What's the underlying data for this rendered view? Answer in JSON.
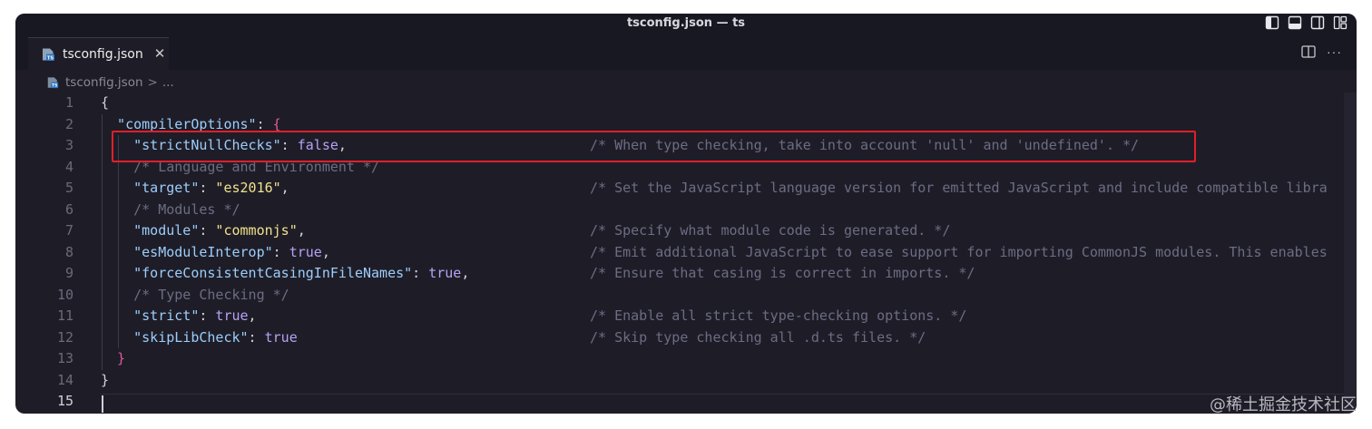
{
  "window": {
    "title": "tsconfig.json — ts"
  },
  "tabs": [
    {
      "label": "tsconfig.json",
      "close_glyph": "✕",
      "icon": "ts-file-icon"
    }
  ],
  "breadcrumb": {
    "file": "tsconfig.json",
    "separator": ">",
    "rest": "..."
  },
  "editor_actions": {
    "more_glyph": "···"
  },
  "colors": {
    "editor_background": "#1e1d27",
    "titlebar_background": "#181822",
    "key": "#9ccdfb",
    "string": "#f1e28e",
    "boolean": "#b7a2f6",
    "comment": "#6c6c84",
    "bracket_level_2": "#e05a9c",
    "highlight_border": "#e0202a"
  },
  "editor": {
    "active_line": "15",
    "lines": [
      {
        "number": "1",
        "punct_open": "{"
      },
      {
        "number": "2",
        "key": "\"compilerOptions\"",
        "colon": ": ",
        "bracket": "{"
      },
      {
        "number": "3",
        "key": "\"strictNullChecks\"",
        "colon": ": ",
        "value": "false",
        "comma": ",",
        "comment": "/* When type checking, take into account 'null' and 'undefined'. */"
      },
      {
        "number": "4",
        "comment_only": "/* Language and Environment */"
      },
      {
        "number": "5",
        "key": "\"target\"",
        "colon": ": ",
        "string": "\"es2016\"",
        "comma": ",",
        "comment": "/* Set the JavaScript language version for emitted JavaScript and include compatible libra"
      },
      {
        "number": "6",
        "comment_only": "/* Modules */"
      },
      {
        "number": "7",
        "key": "\"module\"",
        "colon": ": ",
        "string": "\"commonjs\"",
        "comma": ",",
        "comment": "/* Specify what module code is generated. */"
      },
      {
        "number": "8",
        "key": "\"esModuleInterop\"",
        "colon": ": ",
        "value": "true",
        "comma": ",",
        "comment": "/* Emit additional JavaScript to ease support for importing CommonJS modules. This enables"
      },
      {
        "number": "9",
        "key": "\"forceConsistentCasingInFileNames\"",
        "colon": ": ",
        "value": "true",
        "comma": ",",
        "comment": "/* Ensure that casing is correct in imports. */"
      },
      {
        "number": "10",
        "comment_only": "/* Type Checking */"
      },
      {
        "number": "11",
        "key": "\"strict\"",
        "colon": ": ",
        "value": "true",
        "comma": ",",
        "comment": "/* Enable all strict type-checking options. */"
      },
      {
        "number": "12",
        "key": "\"skipLibCheck\"",
        "colon": ": ",
        "value": "true",
        "comment": "/* Skip type checking all .d.ts files. */"
      },
      {
        "number": "13",
        "bracket": "}"
      },
      {
        "number": "14",
        "punct_open": "}"
      },
      {
        "number": "15"
      }
    ]
  },
  "watermark": "@稀土掘金技术社区"
}
